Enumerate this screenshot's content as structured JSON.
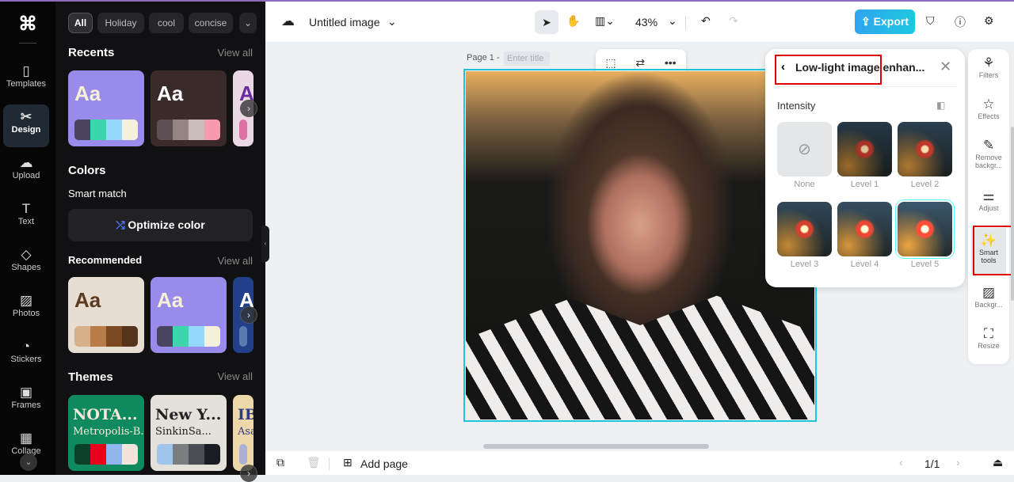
{
  "rail": {
    "items": [
      {
        "label": "Templates",
        "icon": "▯"
      },
      {
        "label": "Design",
        "icon": "✂"
      },
      {
        "label": "Upload",
        "icon": "☁"
      },
      {
        "label": "Text",
        "icon": "T"
      },
      {
        "label": "Shapes",
        "icon": "◇"
      },
      {
        "label": "Photos",
        "icon": "▨"
      },
      {
        "label": "Stickers",
        "icon": "◔"
      },
      {
        "label": "Frames",
        "icon": "▣"
      },
      {
        "label": "Collage",
        "icon": "▦"
      }
    ]
  },
  "panel": {
    "chips": [
      "All",
      "Holiday",
      "cool",
      "concise"
    ],
    "recents": {
      "title": "Recents",
      "view_all": "View all",
      "cards": [
        {
          "aa": "Aa",
          "bg": "#988be9",
          "fg": "#f6f0d8",
          "sw": [
            "#4a4460",
            "#3dd6ac",
            "#94d8fb",
            "#f4f0dc"
          ]
        },
        {
          "aa": "Aa",
          "bg": "#3a2a2a",
          "fg": "#ffffff",
          "sw": [
            "#5e5050",
            "#958585",
            "#cbbcbc",
            "#f89ab0"
          ]
        },
        {
          "aa": "A",
          "bg": "#ead8e4",
          "fg": "#6a2aa0",
          "sw": [
            "#e070a0"
          ]
        }
      ]
    },
    "colors": {
      "title": "Colors",
      "smart_match": "Smart match",
      "optimize": "Optimize color"
    },
    "recommended": {
      "title": "Recommended",
      "view_all": "View all",
      "cards": [
        {
          "aa": "Aa",
          "bg": "#e7ddd2",
          "fg": "#5a3a20",
          "sw": [
            "#d6b088",
            "#b87c48",
            "#7c4a22",
            "#56341c"
          ]
        },
        {
          "aa": "Aa",
          "bg": "#988be9",
          "fg": "#f6f0d8",
          "sw": [
            "#4a4460",
            "#3dd6ac",
            "#94d8fb",
            "#f4f0dc"
          ]
        },
        {
          "aa": "A",
          "bg": "#22408a",
          "fg": "#ffffff",
          "sw": [
            "#5a7ab0"
          ]
        }
      ]
    },
    "themes": {
      "title": "Themes",
      "view_all": "View all",
      "cards": [
        {
          "t1": "NOTA...",
          "t2": "Metropolis-B...",
          "bg": "#0e8a5e",
          "fg": "#f6e8dc",
          "sw": [
            "#0a4028",
            "#e8001c",
            "#90b4ec",
            "#f2e4da"
          ]
        },
        {
          "t1": "New Y...",
          "t2": "SinkinSa...",
          "bg": "#e4e0da",
          "fg": "#222",
          "sw": [
            "#a0c4ec",
            "#7a7e80",
            "#4a4e54",
            "#1a1e22"
          ]
        },
        {
          "t1": "IB",
          "t2": "Asa",
          "bg": "#ecd8a8",
          "fg": "#303a80",
          "sw": [
            "#aab0d8"
          ]
        }
      ]
    }
  },
  "top": {
    "title": "Untitled image",
    "zoom": "43%",
    "export": "Export"
  },
  "canvas": {
    "page_label": "Page 1 -",
    "title_placeholder": "Enter title"
  },
  "smart_panel": {
    "title": "Low-light image enhan...",
    "intensity": "Intensity",
    "options": [
      "None",
      "Level 1",
      "Level 2",
      "Level 3",
      "Level 4",
      "Level 5"
    ],
    "selected": "Level 5"
  },
  "right_tools": [
    {
      "label": "Filters",
      "icon": "⚘"
    },
    {
      "label": "Effects",
      "icon": "☆"
    },
    {
      "label": "Remove backgr...",
      "icon": "✎"
    },
    {
      "label": "Adjust",
      "icon": "⚌"
    },
    {
      "label": "Smart tools",
      "icon": "✨"
    },
    {
      "label": "Backgr...",
      "icon": "▨"
    },
    {
      "label": "Resize",
      "icon": "⛶"
    }
  ],
  "bottom": {
    "add_page": "Add page",
    "page_count": "1/1"
  }
}
